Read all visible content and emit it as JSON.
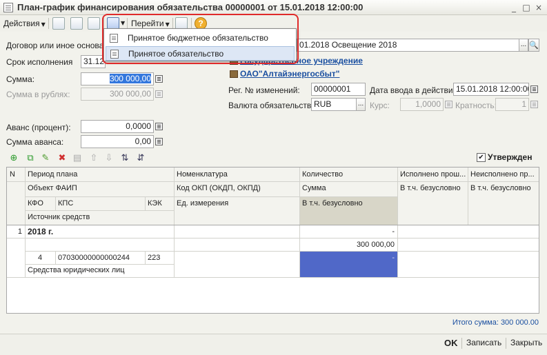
{
  "window": {
    "title": "План-график финансирования обязательства 00000001 от 15.01.2018 12:00:00",
    "window_buttons": [
      "_",
      "□",
      "×"
    ]
  },
  "toolbar": {
    "actions_label": "Действия",
    "goto_label": "Перейти",
    "help_icon": "?"
  },
  "dropdown": {
    "items": [
      {
        "label": "Принятое бюджетное обязательство",
        "icon": "document-icon"
      },
      {
        "label": "Принятое обязательство",
        "icon": "document-icon"
      }
    ]
  },
  "form": {
    "contract_label": "Договор или иное основани",
    "contract_value": "01.2018 Освещение 2018",
    "deadline_label": "Срок исполнения",
    "deadline_value": "31.12.",
    "institution_link": "Государственное учреждение",
    "org_link": "ОАО\"Алтайэнергосбыт\"",
    "sum_label": "Сумма:",
    "sum_value": "300 000,00",
    "sum_rub_label": "Сумма в рублях:",
    "sum_rub_value": "300 000,00",
    "reg_label": "Рег. № изменений:",
    "reg_value": "00000001",
    "entry_date_label": "Дата ввода в действие:",
    "entry_date_value": "15.01.2018 12:00:00",
    "currency_label": "Валюта обязательства:",
    "currency_value": "RUB",
    "rate_label": "Курс:",
    "rate_value": "1,0000",
    "multiplicity_label": "Кратность:",
    "multiplicity_value": "1",
    "advance_pct_label": "Аванс (процент):",
    "advance_pct_value": "0,0000",
    "advance_sum_label": "Сумма аванса:",
    "advance_sum_value": "0,00",
    "approved_label": "Утвержден",
    "approved_check": "✔"
  },
  "table": {
    "headers": {
      "n": "N",
      "period": "Период плана",
      "object": "Объект ФАИП",
      "kfo": "КФО",
      "kps": "КПС",
      "kek": "КЭК",
      "source": "Источник средств",
      "nomenclature": "Номенклатура",
      "okp": "Код ОКП (ОКДП, ОКПД)",
      "unit": "Ед. измерения",
      "qty": "Количество",
      "sum": "Сумма",
      "incl_uncond": "В т.ч. безусловно",
      "executed": "Исполнено прош...",
      "executed_incl": "В т.ч. безусловно",
      "unexecuted": "Неисполнено пр...",
      "unexecuted_incl": "В т.ч. безусловно"
    },
    "row": {
      "n": "1",
      "period": "2018 г.",
      "qty": "-",
      "sum": "300 000,00",
      "kfo": "4",
      "kps": "07030000000000244",
      "kek": "223",
      "incl": "-",
      "source": "Средства юридических лиц"
    }
  },
  "footer": {
    "total": "Итого сумма: 300 000.00",
    "ok": "OK",
    "save": "Записать",
    "close": "Закрыть"
  },
  "colors": {
    "highlight_cell": "#5068c8",
    "link": "#1a4fa0",
    "callout": "#e02a2a"
  }
}
